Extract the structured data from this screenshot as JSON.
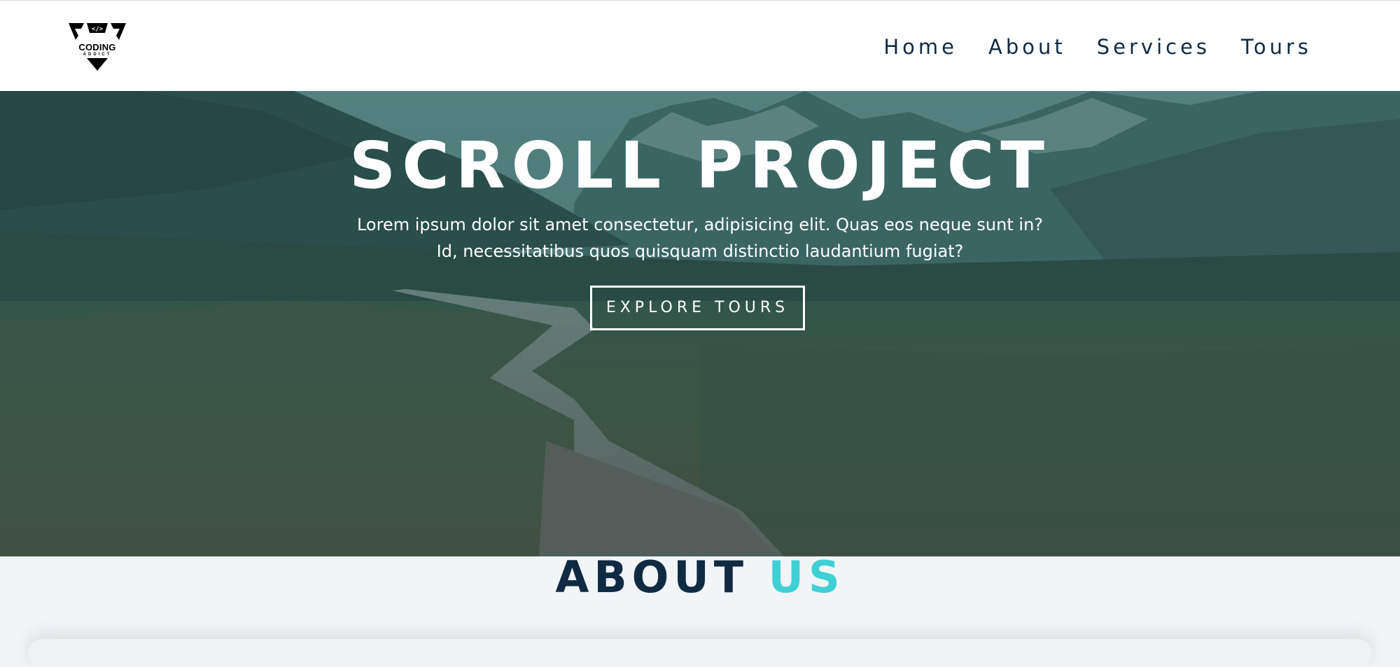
{
  "logo": {
    "main_text": "CODING",
    "sub_text": "ADDICT",
    "icon": "code-brackets-icon"
  },
  "nav": {
    "links": [
      {
        "label": "Home"
      },
      {
        "label": "About"
      },
      {
        "label": "Services"
      },
      {
        "label": "Tours"
      }
    ]
  },
  "hero": {
    "title": "SCROLL PROJECT",
    "text": "Lorem ipsum dolor sit amet consectetur, adipisicing elit. Quas eos neque sunt in? Id, necessitatibus quos quisquam distinctio laudantium fugiat?",
    "button_label": "EXPLORE TOURS"
  },
  "about": {
    "title_main": "ABOUT",
    "title_accent": "US"
  },
  "colors": {
    "primary_dark": "#102a42",
    "accent": "#3fd0d4",
    "background": "#f1f5f8"
  }
}
